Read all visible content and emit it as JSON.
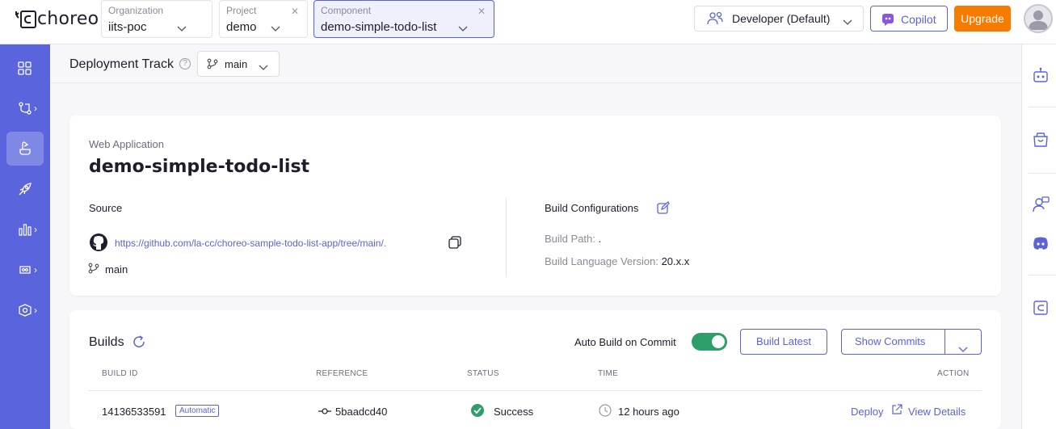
{
  "header": {
    "logo_text": "choreo",
    "organization": {
      "label": "Organization",
      "value": "iits-poc"
    },
    "project": {
      "label": "Project",
      "value": "demo"
    },
    "component": {
      "label": "Component",
      "value": "demo-simple-todo-list"
    },
    "role": "Developer (Default)",
    "copilot": "Copilot",
    "upgrade": "Upgrade"
  },
  "track": {
    "title": "Deployment Track",
    "help": "?",
    "branch": "main"
  },
  "overview": {
    "kind": "Web Application",
    "name": "demo-simple-todo-list",
    "source_title": "Source",
    "repo_url": "https://github.com/la-cc/choreo-sample-todo-list-app/tree/main/.",
    "branch": "main",
    "build_config_title": "Build Configurations",
    "build_path_label": "Build Path:",
    "build_path_value": ".",
    "build_lang_label": "Build Language Version:",
    "build_lang_value": "20.x.x"
  },
  "builds": {
    "title": "Builds",
    "auto_build_label": "Auto Build on Commit",
    "auto_build_on": true,
    "build_latest": "Build Latest",
    "show_commits": "Show Commits",
    "columns": [
      "BUILD ID",
      "REFERENCE",
      "STATUS",
      "TIME",
      "ACTION"
    ],
    "rows": [
      {
        "build_id": "14136533591",
        "trigger": "Automatic",
        "reference": "5baadcd40",
        "status": "Success",
        "time": "12 hours ago",
        "deploy": "Deploy",
        "view_details": "View Details"
      }
    ]
  },
  "colors": {
    "accent": "#5b63d3",
    "nav_bg": "#5a64dc",
    "upgrade": "#f57c00",
    "success": "#2e9e6b"
  }
}
